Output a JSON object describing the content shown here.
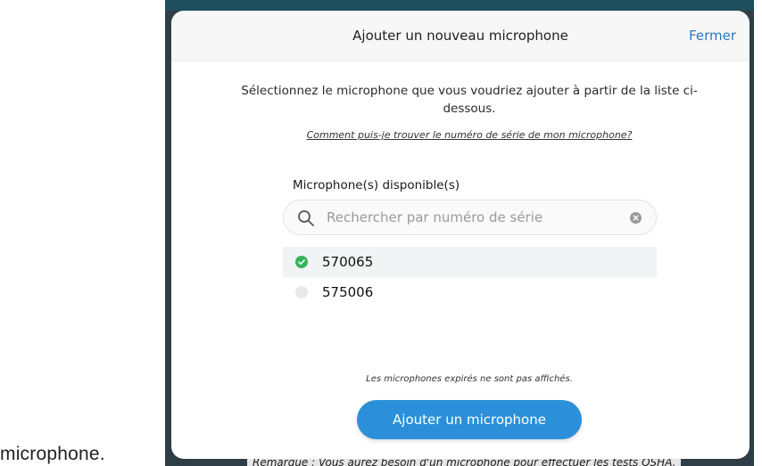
{
  "background": {
    "word": "microphone.",
    "note": "Remarque : Vous aurez besoin d'un microphone pour effectuer les tests OSHA."
  },
  "modal": {
    "title": "Ajouter un nouveau microphone",
    "close_label": "Fermer",
    "instructions": "Sélectionnez le microphone que vous voudriez ajouter à partir de la liste ci-dessous.",
    "help_link": "Comment puis-je trouver le numéro de série de mon microphone?",
    "section_label": "Microphone(s) disponible(s)",
    "search": {
      "placeholder": "Rechercher par numéro de série",
      "value": ""
    },
    "microphones": [
      {
        "serial": "570065",
        "selected": true
      },
      {
        "serial": "575006",
        "selected": false
      }
    ],
    "footnote": "Les microphones expirés ne sont pas affichés.",
    "primary_button": "Ajouter un microphone"
  },
  "colors": {
    "accent": "#2b90d9",
    "link": "#2a7abf",
    "check_green": "#35b45a",
    "backdrop": "#2f3e46"
  },
  "icons": [
    "search-icon",
    "clear-icon",
    "check-icon"
  ]
}
